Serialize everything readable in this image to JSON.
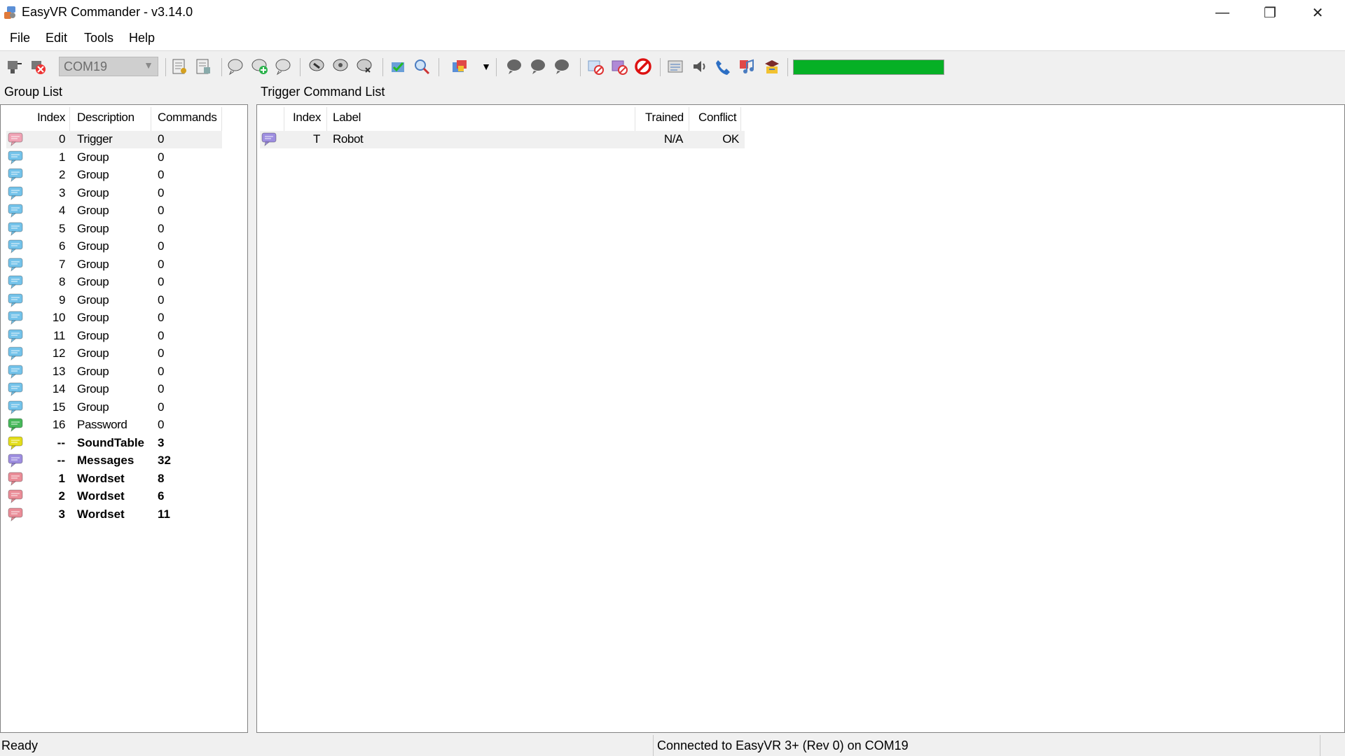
{
  "window": {
    "title": "EasyVR Commander - v3.14.0",
    "minimize_glyph": "—",
    "maximize_glyph": "❐",
    "close_glyph": "✕"
  },
  "menu": [
    "File",
    "Edit",
    "Tools",
    "Help"
  ],
  "toolbar": {
    "port": "COM19",
    "progress_fraction": 1.0,
    "progress_color": "#06b025",
    "icons": [
      "connect-icon",
      "disconnect-icon",
      "open-icon",
      "save-icon",
      "add-group-icon",
      "add-command-icon",
      "remove-command-icon",
      "train-icon",
      "test-icon",
      "erase-icon",
      "verify-icon",
      "search-icon",
      "sound-icon",
      "dropdown-icon",
      "speak-icon",
      "recog-icon",
      "voice-icon",
      "stop-icon",
      "cancel-icon",
      "block-icon",
      "message-icon",
      "volume-icon",
      "phone-icon",
      "music-icon",
      "update-icon"
    ]
  },
  "group_panel": {
    "title": "Group List",
    "columns": {
      "index": "Index",
      "description": "Description",
      "commands": "Commands"
    },
    "rows": [
      {
        "index": "0",
        "description": "Trigger",
        "commands": "0",
        "color": "pink",
        "bold": false,
        "selected": true
      },
      {
        "index": "1",
        "description": "Group",
        "commands": "0",
        "color": "blue",
        "bold": false
      },
      {
        "index": "2",
        "description": "Group",
        "commands": "0",
        "color": "blue",
        "bold": false
      },
      {
        "index": "3",
        "description": "Group",
        "commands": "0",
        "color": "blue",
        "bold": false
      },
      {
        "index": "4",
        "description": "Group",
        "commands": "0",
        "color": "blue",
        "bold": false
      },
      {
        "index": "5",
        "description": "Group",
        "commands": "0",
        "color": "blue",
        "bold": false
      },
      {
        "index": "6",
        "description": "Group",
        "commands": "0",
        "color": "blue",
        "bold": false
      },
      {
        "index": "7",
        "description": "Group",
        "commands": "0",
        "color": "blue",
        "bold": false
      },
      {
        "index": "8",
        "description": "Group",
        "commands": "0",
        "color": "blue",
        "bold": false
      },
      {
        "index": "9",
        "description": "Group",
        "commands": "0",
        "color": "blue",
        "bold": false
      },
      {
        "index": "10",
        "description": "Group",
        "commands": "0",
        "color": "blue",
        "bold": false
      },
      {
        "index": "11",
        "description": "Group",
        "commands": "0",
        "color": "blue",
        "bold": false
      },
      {
        "index": "12",
        "description": "Group",
        "commands": "0",
        "color": "blue",
        "bold": false
      },
      {
        "index": "13",
        "description": "Group",
        "commands": "0",
        "color": "blue",
        "bold": false
      },
      {
        "index": "14",
        "description": "Group",
        "commands": "0",
        "color": "blue",
        "bold": false
      },
      {
        "index": "15",
        "description": "Group",
        "commands": "0",
        "color": "blue",
        "bold": false
      },
      {
        "index": "16",
        "description": "Password",
        "commands": "0",
        "color": "green",
        "bold": false
      },
      {
        "index": "--",
        "description": "SoundTable",
        "commands": "3",
        "color": "yellow",
        "bold": true
      },
      {
        "index": "--",
        "description": "Messages",
        "commands": "32",
        "color": "purple",
        "bold": true
      },
      {
        "index": "1",
        "description": "Wordset",
        "commands": "8",
        "color": "red",
        "bold": true
      },
      {
        "index": "2",
        "description": "Wordset",
        "commands": "6",
        "color": "red",
        "bold": true
      },
      {
        "index": "3",
        "description": "Wordset",
        "commands": "11",
        "color": "red",
        "bold": true
      }
    ]
  },
  "trigger_panel": {
    "title": "Trigger Command List",
    "columns": {
      "index": "Index",
      "label": "Label",
      "trained": "Trained",
      "conflict": "Conflict"
    },
    "rows": [
      {
        "index": "T",
        "label": "Robot",
        "trained": "N/A",
        "conflict": "OK",
        "color": "purple"
      }
    ]
  },
  "colors": {
    "blue": "#74c3ea",
    "pink": "#f0a3b5",
    "green": "#47b85a",
    "yellow": "#e3dd1b",
    "purple": "#9e8ee0",
    "red": "#ea8d98"
  },
  "status": {
    "left": "Ready",
    "right": "Connected to EasyVR 3+ (Rev 0) on COM19"
  }
}
